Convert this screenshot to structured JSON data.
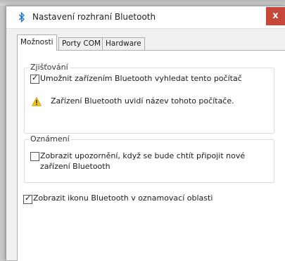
{
  "window": {
    "title": "Nastavení rozhraní Bluetooth",
    "close_glyph": "x"
  },
  "tabs": [
    {
      "label": "Možnosti",
      "active": true
    },
    {
      "label": "Porty COM",
      "active": false
    },
    {
      "label": "Hardware",
      "active": false
    }
  ],
  "discovery": {
    "legend": "Zjišťování",
    "allow_discovery": {
      "label": "Umožnit zařízením Bluetooth vyhledat tento počítač",
      "checked": true
    },
    "warning_text": "Zařízení Bluetooth uvidí název tohoto počítače."
  },
  "notifications": {
    "legend": "Oznámení",
    "alert_new_device": {
      "label_line1": "Zobrazit upozornění, když se bude chtít připojit nové",
      "label_line2": "zařízení Bluetooth",
      "checked": false
    }
  },
  "show_icon": {
    "label": "Zobrazit ikonu Bluetooth v oznamovací oblasti",
    "checked": true
  },
  "colors": {
    "accent": "#1e6fcf",
    "close": "#c7473a",
    "warning": "#f2c200"
  }
}
